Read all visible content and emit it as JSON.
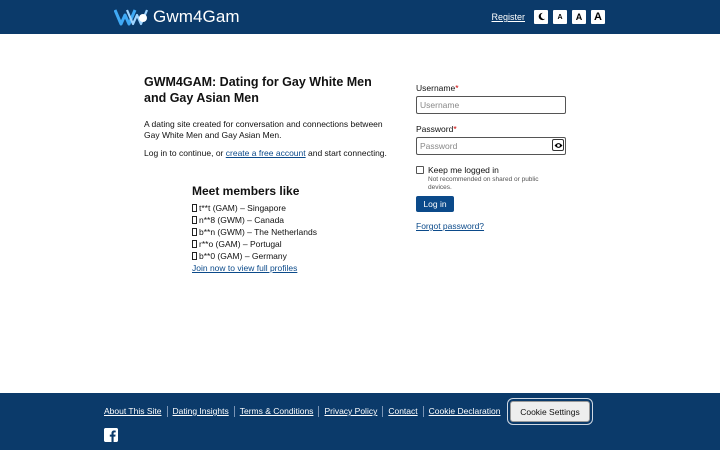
{
  "header": {
    "brand": "Gwm4Gam",
    "register_label": "Register",
    "dark_mode_icon": "moon-icon",
    "font_buttons": [
      "A",
      "A",
      "A"
    ]
  },
  "intro": {
    "title": "GWM4GAM: Dating for Gay White Men and Gay Asian Men",
    "description": "A dating site created for conversation and connections between Gay White Men and Gay Asian Men.",
    "login_prefix": "Log in to continue, or ",
    "create_account_link": "create a free account",
    "login_suffix": " and start connecting."
  },
  "members": {
    "heading": "Meet members like",
    "items": [
      "t**t (GAM) – Singapore",
      "n**8 (GWM) – Canada",
      "b**n (GWM) – The Netherlands",
      "r**o (GAM) – Portugal",
      "b**0 (GAM) – Germany"
    ],
    "join_link": "Join now to view full profiles"
  },
  "form": {
    "username_label": "Username",
    "username_placeholder": "Username",
    "password_label": "Password",
    "password_placeholder": "Password",
    "required_mark": "*",
    "keep_logged_in": "Keep me logged in",
    "keep_hint": "Not recommended on shared or public devices.",
    "login_button": "Log in",
    "forgot_link": "Forgot password?"
  },
  "footer": {
    "links": [
      "About This Site",
      "Dating Insights",
      "Terms & Conditions",
      "Privacy Policy",
      "Contact",
      "Cookie Declaration"
    ],
    "cookie_button": "Cookie Settings",
    "social_icon": "facebook-icon"
  },
  "colors": {
    "header_bg": "#0b3a6a",
    "link": "#0b4a8a",
    "button_bg": "#0b4a8a",
    "required": "#cc0000"
  }
}
